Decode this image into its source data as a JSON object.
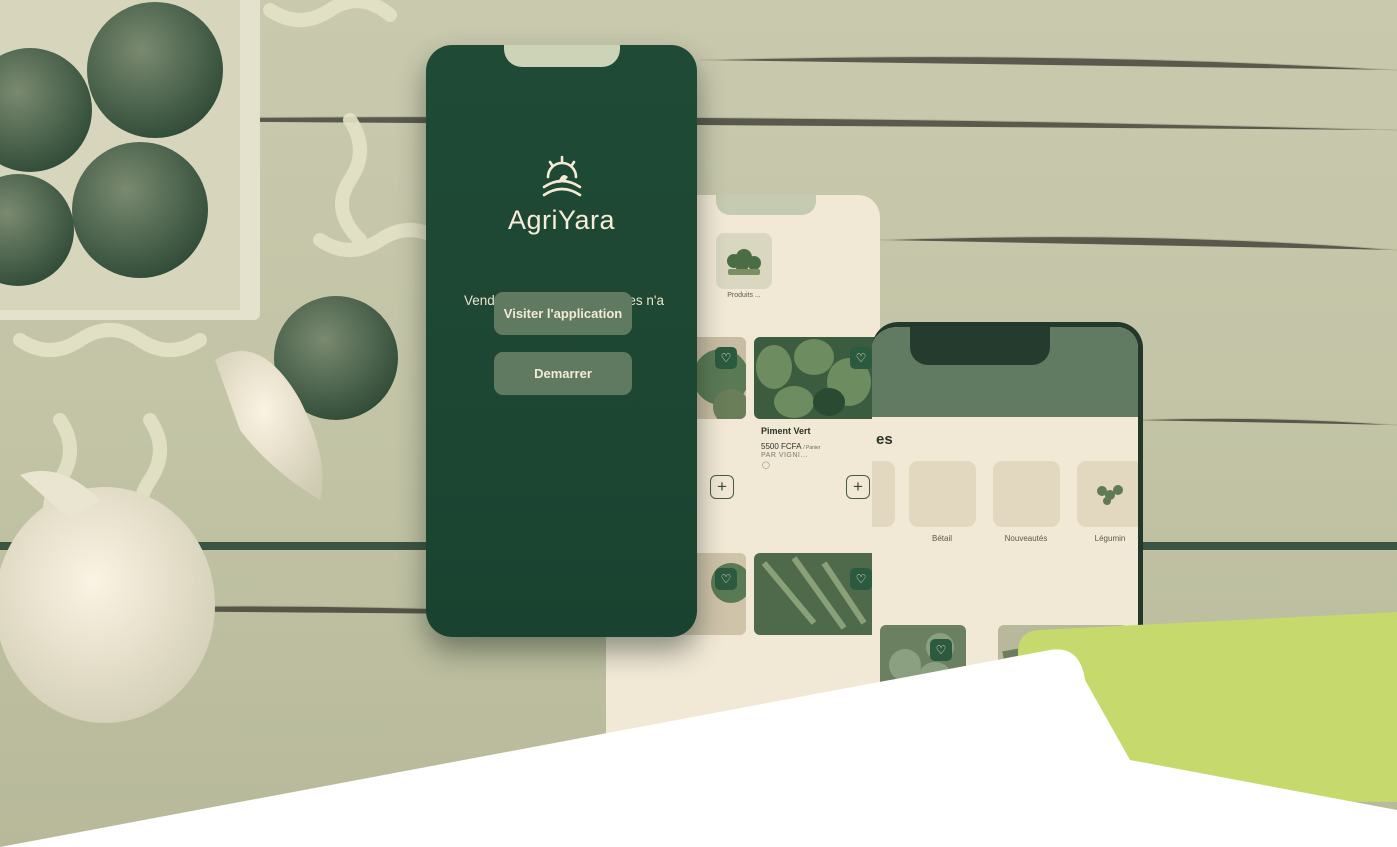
{
  "splash": {
    "brand": "AgriYara",
    "tagline": "Vendre et acheter les recoltes n'a jamais été aussi facile!",
    "visit_button": "Visiter l'application",
    "start_button": "Demarrer"
  },
  "catalog": {
    "category_label": "Produits ...",
    "product": {
      "name": "Piment Vert",
      "price": "5500 FCFA",
      "unit": "/ Panier",
      "seller": "PAR VIGNI..."
    }
  },
  "home": {
    "section_title": "es",
    "categories": [
      "Bétail",
      "Nouveautés",
      "Légumin"
    ]
  },
  "colors": {
    "brand_green": "#1f4a35",
    "button": "#5f7a61",
    "cream": "#f2e8d6",
    "accent": "#c5d96d"
  }
}
